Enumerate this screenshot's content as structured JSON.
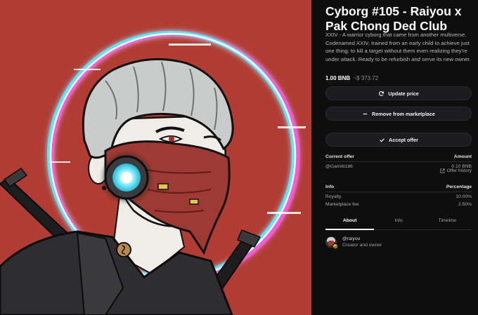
{
  "artwork": {
    "label": "Cyborg artwork",
    "colors": {
      "background": "#b13c33",
      "halo_cyan": "#56e6ff",
      "halo_magenta": "#f25bd8",
      "mask": "#9e3a33",
      "hair": "#c9cccb",
      "jacket": "#2e2e30"
    }
  },
  "nft": {
    "title": "Cyborg #105 - Raiyou x Pak Chong Ded Club",
    "description": "XXIV - A warrior cyborg that came from another multiverse. Codenamed XXIV, trained from an early child to achieve just one thing: to kill a target without them even realizing they're under attack. Ready to be refurbish and serve its new owner.",
    "price_bnb": "1.00 BNB",
    "price_usd": "~$ 373.72"
  },
  "actions": {
    "update_price": {
      "label": "Update price",
      "icon": "refresh-icon"
    },
    "remove_from_marketplace": {
      "label": "Remove from marketplace",
      "icon": "minus-icon"
    },
    "accept_offer": {
      "label": "Accept offer",
      "icon": "check-icon"
    }
  },
  "offer_table": {
    "headers": [
      "Current offer",
      "Amount"
    ],
    "rows": [
      {
        "from": "@Garrett186",
        "amount": "0.10 BNB"
      }
    ],
    "history_link": {
      "label": "Offer history",
      "icon": "external-link-icon"
    }
  },
  "info_table": {
    "headers": [
      "Info",
      "Percentage"
    ],
    "rows": [
      {
        "label": "Royalty",
        "value": "10.00%"
      },
      {
        "label": "Marketplace fee",
        "value": "2.50%"
      }
    ]
  },
  "tabs": [
    {
      "label": "About",
      "active": true
    },
    {
      "label": "Info",
      "active": false
    },
    {
      "label": "Timeline",
      "active": false
    }
  ],
  "owner": {
    "username": "@raiyou",
    "role": "Creator and owner",
    "verified_icon": "check-badge-icon"
  }
}
